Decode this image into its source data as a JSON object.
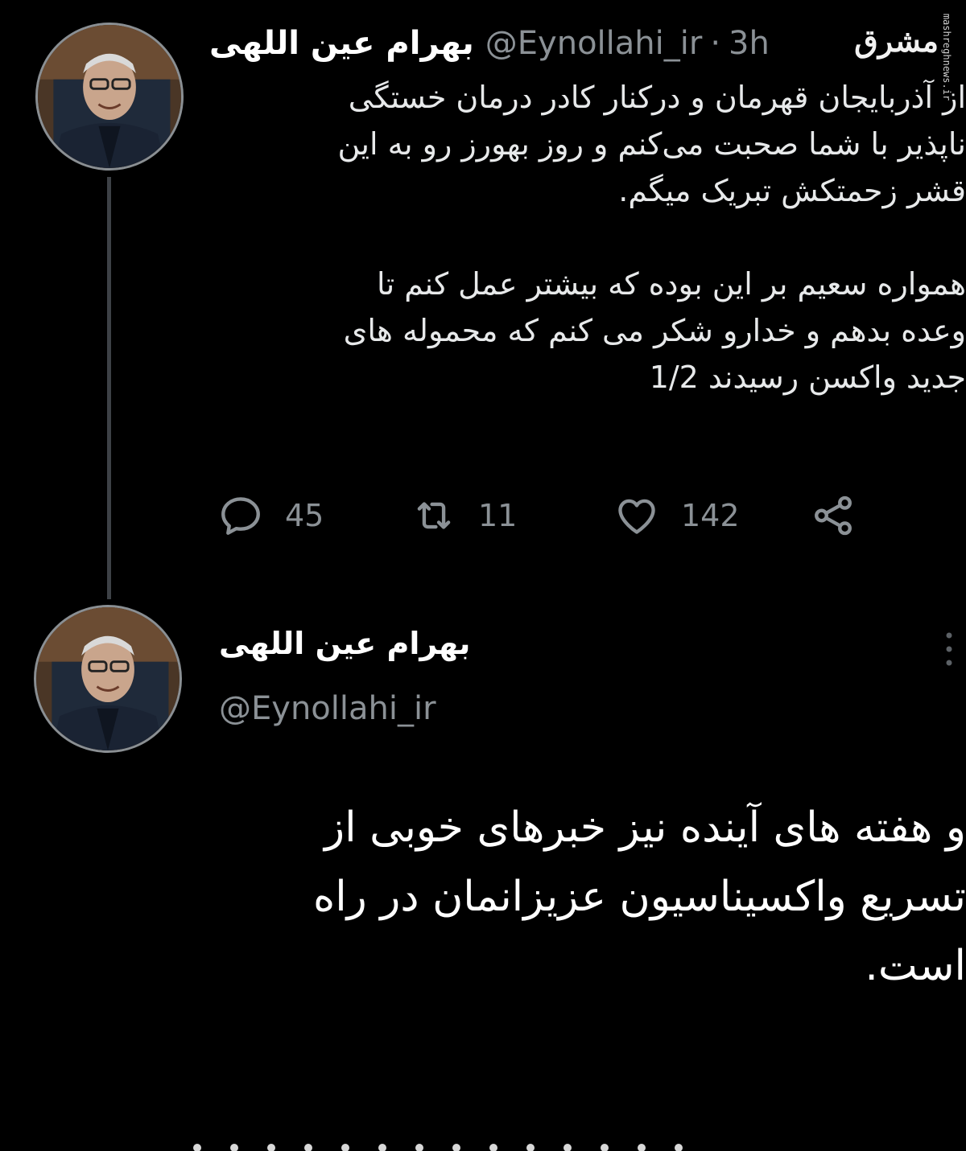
{
  "tweet1": {
    "author_name": "بهرام عین اللهی",
    "handle": "@Eynollahi_ir",
    "separator": "·",
    "time": "3h",
    "lines": [
      "از آذربایجان قهرمان و درکنار کادر درمان خستگی",
      "ناپذیر با شما صحبت می‌کنم و روز بهورز رو به این",
      "قشر زحمتکش تبریک میگم.",
      "همواره سعیم بر این بوده که بیشتر عمل کنم تا",
      "وعده بدهم و خدارو شکر می کنم که محموله های",
      "جدید واکسن رسیدند 1/2"
    ],
    "actions": {
      "reply_count": "45",
      "retweet_count": "11",
      "like_count": "142"
    }
  },
  "tweet2": {
    "author_name": "بهرام عین اللهی",
    "handle": "@Eynollahi_ir",
    "lines": [
      "و هفته های آینده نیز خبرهای خوبی از",
      "تسریع واکسیناسیون عزیزانمان در راه",
      "است."
    ]
  },
  "watermark": {
    "logo": "مشرق",
    "site": "mashreghnews.ir"
  },
  "icons": {
    "reply": "speech-bubble-icon",
    "retweet": "retweet-icon",
    "like": "heart-icon",
    "share": "share-icon",
    "more": "more-options-icon"
  },
  "colors": {
    "background": "#000000",
    "primary_text": "#e7e9ea",
    "secondary_text": "#8b9196",
    "thread_line": "#3d4146"
  }
}
